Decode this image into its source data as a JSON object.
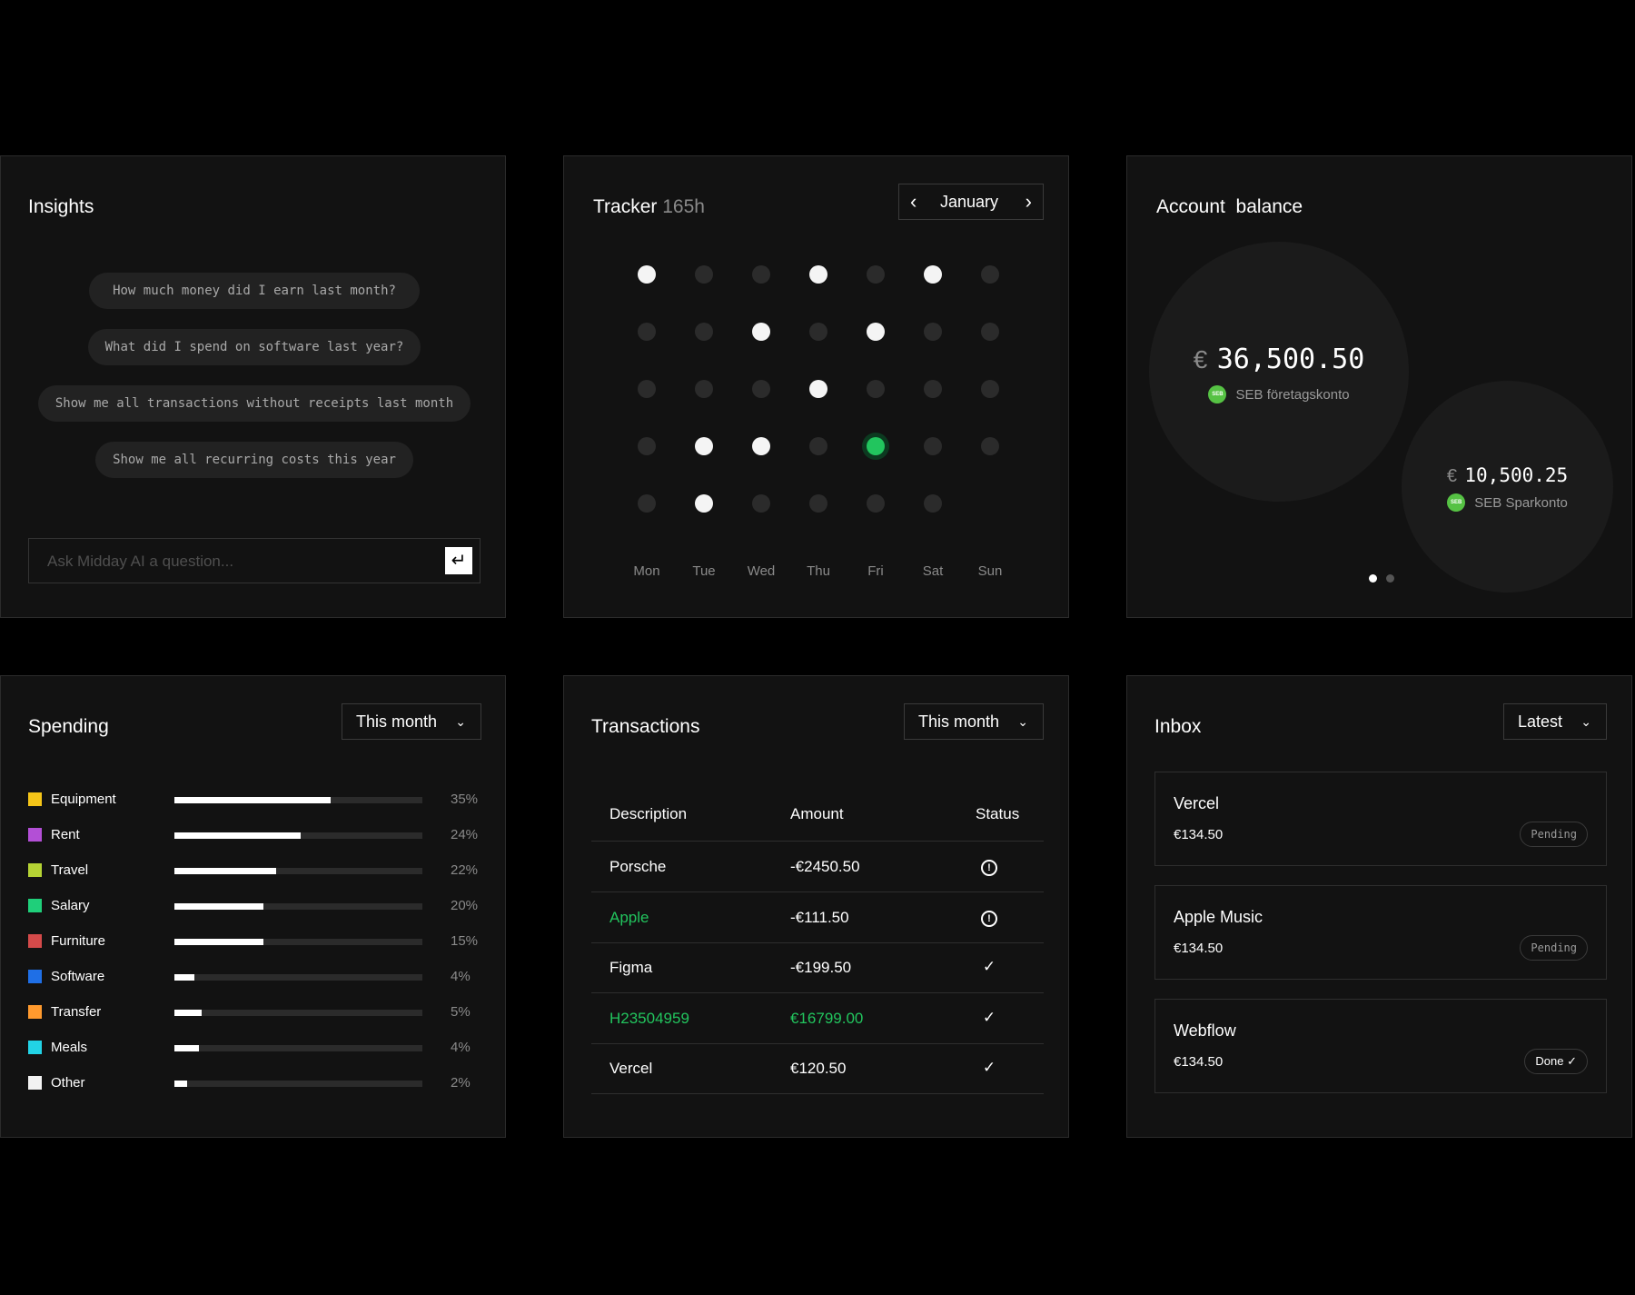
{
  "insights": {
    "title": "Insights",
    "questions": [
      "How much money did I earn last month?",
      "What did I spend on software last year?",
      "Show me all transactions without receipts last month",
      "Show me all recurring costs this year"
    ],
    "input_placeholder": "Ask Midday AI a question...",
    "enter_glyph": "↵"
  },
  "tracker": {
    "title": "Tracker",
    "hours": "165h",
    "month": "January",
    "prev_glyph": "‹",
    "next_glyph": "›",
    "days": [
      "Mon",
      "Tue",
      "Wed",
      "Thu",
      "Fri",
      "Sat",
      "Sun"
    ],
    "grid": [
      [
        "on",
        "off",
        "off",
        "on",
        "off",
        "on",
        "off"
      ],
      [
        "off",
        "off",
        "on",
        "off",
        "on",
        "off",
        "off"
      ],
      [
        "off",
        "off",
        "off",
        "on",
        "off",
        "off",
        "off"
      ],
      [
        "off",
        "on",
        "on",
        "off",
        "active",
        "off",
        "off"
      ],
      [
        "off",
        "on",
        "off",
        "off",
        "off",
        "off",
        ""
      ]
    ]
  },
  "account_balance": {
    "title": "Account  balance",
    "accounts": [
      {
        "currency": "€",
        "amount": "36,500.50",
        "name": "SEB företagskonto",
        "logo": "SEB"
      },
      {
        "currency": "€",
        "amount": "10,500.25",
        "name": "SEB Sparkonto",
        "logo": "SEB"
      }
    ],
    "page_count": 2,
    "active_page": 0
  },
  "spending": {
    "title": "Spending",
    "period": "This month",
    "chevron": "⌄",
    "categories": [
      {
        "label": "Equipment",
        "percent_text": "35%",
        "fill": 0.63,
        "color": "#f5c518"
      },
      {
        "label": "Rent",
        "percent_text": "24%",
        "fill": 0.51,
        "color": "#b34fd6"
      },
      {
        "label": "Travel",
        "percent_text": "22%",
        "fill": 0.41,
        "color": "#b5d334"
      },
      {
        "label": "Salary",
        "percent_text": "20%",
        "fill": 0.36,
        "color": "#1fcf7a"
      },
      {
        "label": "Furniture",
        "percent_text": "15%",
        "fill": 0.36,
        "color": "#d44a4a"
      },
      {
        "label": "Software",
        "percent_text": "4%",
        "fill": 0.08,
        "color": "#1f6fe6"
      },
      {
        "label": "Transfer",
        "percent_text": "5%",
        "fill": 0.11,
        "color": "#ff9a2e"
      },
      {
        "label": "Meals",
        "percent_text": "4%",
        "fill": 0.1,
        "color": "#22d3e6"
      },
      {
        "label": "Other",
        "percent_text": "2%",
        "fill": 0.05,
        "color": "#f2f2f2"
      }
    ]
  },
  "transactions": {
    "title": "Transactions",
    "period": "This month",
    "chevron": "⌄",
    "columns": [
      "Description",
      "Amount",
      "Status"
    ],
    "rows": [
      {
        "description": "Porsche",
        "amount": "-€2450.50",
        "status": "alert",
        "desc_green": false,
        "amount_green": false
      },
      {
        "description": "Apple",
        "amount": "-€111.50",
        "status": "alert",
        "desc_green": true,
        "amount_green": false
      },
      {
        "description": "Figma",
        "amount": "-€199.50",
        "status": "check",
        "desc_green": false,
        "amount_green": false
      },
      {
        "description": "H23504959",
        "amount": "€16799.00",
        "status": "check",
        "desc_green": true,
        "amount_green": true
      },
      {
        "description": "Vercel",
        "amount": "€120.50",
        "status": "check",
        "desc_green": false,
        "amount_green": false
      }
    ]
  },
  "inbox": {
    "title": "Inbox",
    "sort": "Latest",
    "chevron": "⌄",
    "items": [
      {
        "name": "Vercel",
        "amount": "€134.50",
        "status": "Pending"
      },
      {
        "name": "Apple Music",
        "amount": "€134.50",
        "status": "Pending"
      },
      {
        "name": "Webflow",
        "amount": "€134.50",
        "status": "Done ✓"
      }
    ]
  }
}
